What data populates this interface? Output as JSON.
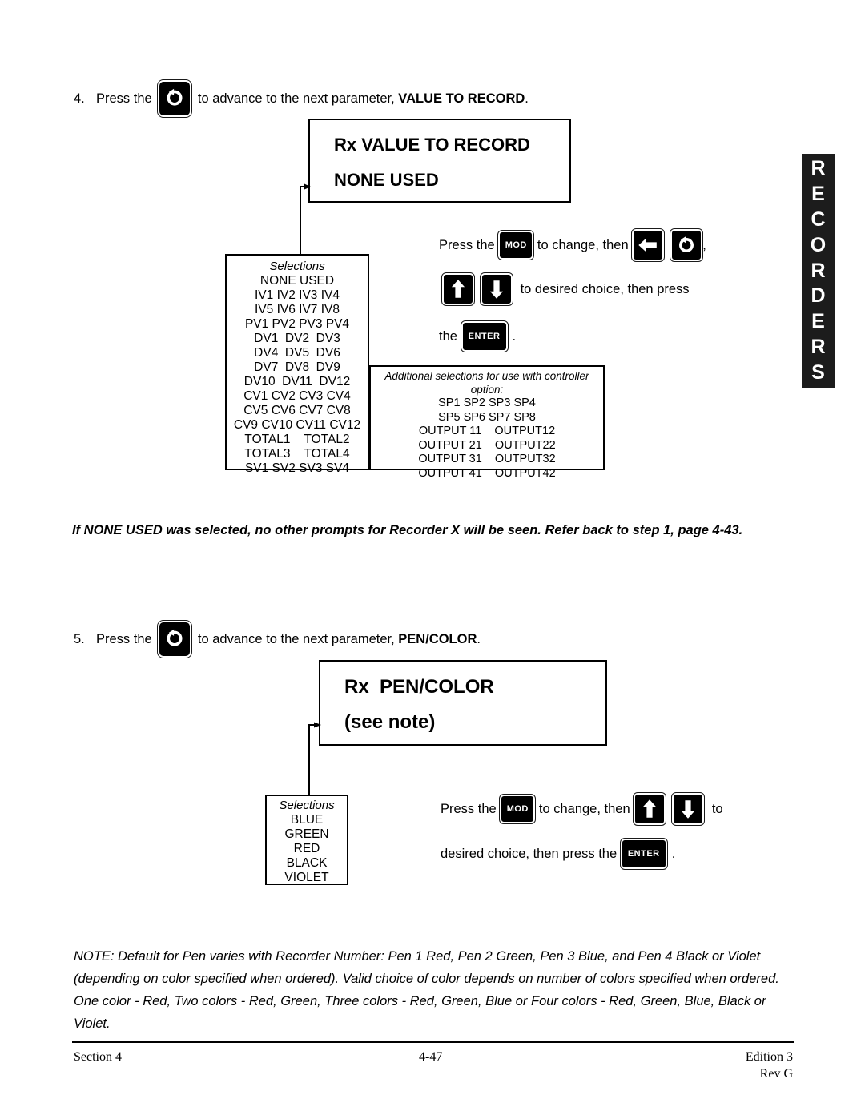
{
  "page": {
    "section": "Section 4",
    "page_number": "4-47",
    "edition": "Edition 3",
    "revision": "Rev G",
    "side_tab": "RECORDERS"
  },
  "step4": {
    "number": "4.",
    "text_before": "Press the ",
    "key": "display-loop-key",
    "text_middle": " to advance to the next parameter, ",
    "parameter": "VALUE TO RECORD",
    "text_after": "."
  },
  "display1": {
    "line1": "Rx VALUE TO RECORD",
    "line2": "NONE USED"
  },
  "selections1": {
    "title": "Selections",
    "rows": [
      "NONE USED",
      "IV1 IV2 IV3 IV4",
      "IV5 IV6 IV7 IV8",
      "PV1 PV2 PV3 PV4",
      "DV1  DV2  DV3",
      "DV4  DV5  DV6",
      "DV7  DV8  DV9",
      "DV10  DV11  DV12",
      "CV1 CV2 CV3 CV4",
      "CV5 CV6 CV7 CV8",
      "CV9 CV10 CV11 CV12",
      "TOTAL1    TOTAL2",
      "TOTAL3    TOTAL4",
      "SV1 SV2 SV3 SV4"
    ]
  },
  "selections1_extra": {
    "title": "Additional selections for use with controller option:",
    "rows": [
      "SP1 SP2 SP3 SP4",
      "SP5 SP6 SP7 SP8",
      "OUTPUT 11    OUTPUT12",
      "OUTPUT 21    OUTPUT22",
      "OUTPUT 31    OUTPUT32",
      "OUTPUT 41    OUTPUT42"
    ]
  },
  "instructions1": {
    "t1": "Press the ",
    "key_mod": "MOD",
    "t2": " to change, then ",
    "key_left": "left-arrow-key",
    "key_loop": "display-loop-key",
    "t3": ",",
    "key_up": "up-arrow-key",
    "key_down": "down-arrow-key",
    "t4": " to desired choice, then press",
    "t5": "the ",
    "key_enter": "ENTER",
    "t6": "."
  },
  "note_none_used": "If NONE USED was selected, no other prompts for Recorder X will be seen.  Refer back to step 1, page 4-43.",
  "step5": {
    "number": "5.",
    "text_before": "Press the ",
    "key": "display-loop-key",
    "text_middle": " to advance to the next parameter, ",
    "parameter": "PEN/COLOR",
    "text_after": "."
  },
  "display2": {
    "line1": "Rx  PEN/COLOR",
    "line2": "(see note)"
  },
  "selections2": {
    "title": "Selections",
    "rows": [
      "BLUE",
      "GREEN",
      "RED",
      "BLACK",
      "VIOLET"
    ]
  },
  "instructions2": {
    "t1": "Press the ",
    "key_mod": "MOD",
    "t2": " to change, then ",
    "key_up": "up-arrow-key",
    "key_down": "down-arrow-key",
    "t3": " to",
    "t4": "desired choice, then press the ",
    "key_enter": "ENTER",
    "t5": "."
  },
  "note_pen": "NOTE:  Default for Pen varies with Recorder Number: Pen 1 Red, Pen 2 Green, Pen 3 Blue, and Pen 4 Black or Violet (depending on color specified when ordered).  Valid choice of color depends on number of colors specified when ordered.  One color - Red, Two colors - Red, Green, Three colors - Red, Green, Blue or Four colors - Red, Green, Blue, Black or Violet."
}
